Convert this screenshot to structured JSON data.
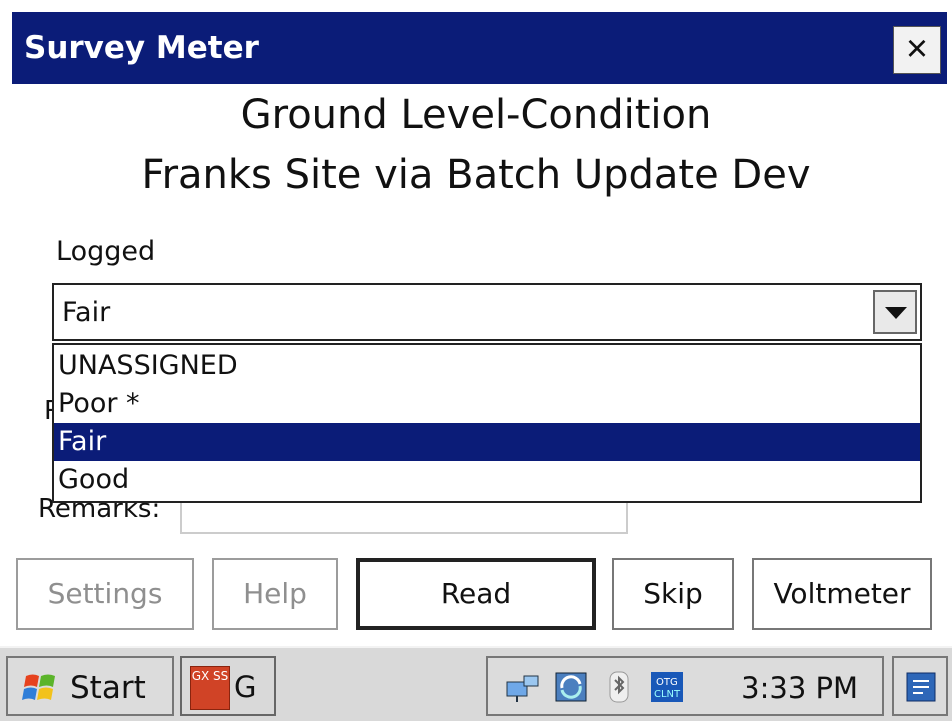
{
  "window": {
    "title": "Survey Meter",
    "close_label": "×"
  },
  "header": {
    "line1": "Ground Level-Condition",
    "line2": "Franks Site via Batch Update Dev"
  },
  "logged": {
    "label": "Logged",
    "selected": "Fair",
    "options": [
      "UNASSIGNED",
      "Poor *",
      "Fair",
      "Good"
    ]
  },
  "remarks": {
    "label": "Remarks:",
    "value": ""
  },
  "hidden_label_fragment": "R",
  "buttons": {
    "settings": "Settings",
    "help": "Help",
    "read": "Read",
    "skip": "Skip",
    "voltmeter": "Voltmeter"
  },
  "taskbar": {
    "start_label": "Start",
    "app_label": "G",
    "app_icon_text": "GX SS",
    "time": "3:33 PM"
  },
  "colors": {
    "titlebar": "#0b1c78",
    "selection": "#0b1c78",
    "taskbar": "#d9d9d9"
  }
}
